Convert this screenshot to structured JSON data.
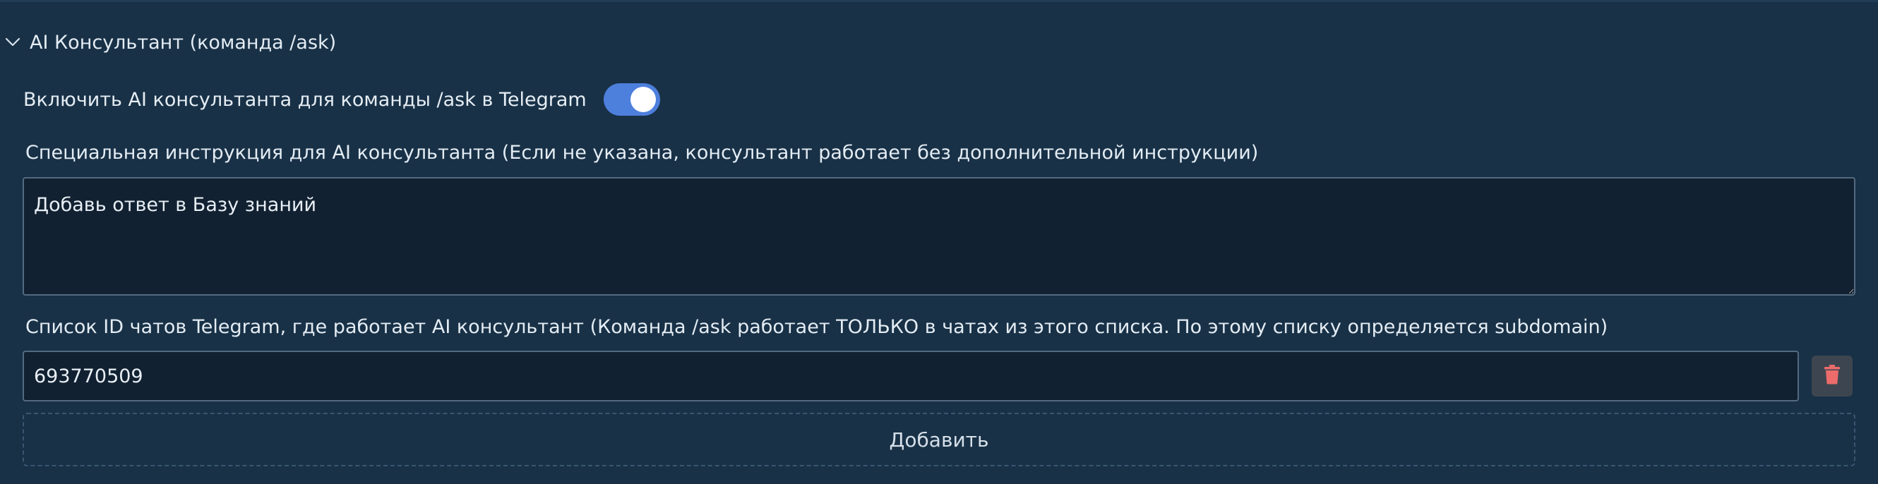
{
  "colors": {
    "background": "#183147",
    "input_background": "#112131",
    "toggle_on": "#4d7fdc",
    "delete_icon": "#ec6b6b"
  },
  "section": {
    "title": "AI Консультант (команда /ask)",
    "expanded": true,
    "chevron_icon": "chevron-down-icon"
  },
  "toggle": {
    "label": "Включить AI консультанта для команды /ask в Telegram",
    "enabled": true
  },
  "instruction": {
    "label": "Специальная инструкция для AI консультанта (Если не указана, консультант работает без дополнительной инструкции)",
    "value": "Добавь ответ в Базу знаний"
  },
  "chats": {
    "label": "Список ID чатов Telegram, где работает AI консультант (Команда /ask работает ТОЛЬКО в чатах из этого списка. По этому списку определяется subdomain)",
    "items": [
      {
        "value": "693770509",
        "delete_icon": "trash-icon"
      }
    ],
    "add_label": "Добавить"
  }
}
